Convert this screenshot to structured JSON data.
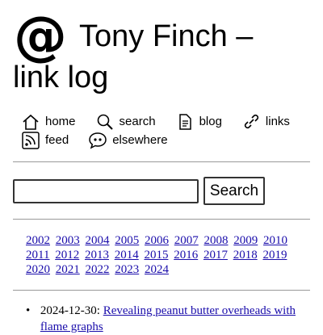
{
  "header": {
    "logo_glyph": "@",
    "title_line1": "Tony Finch –",
    "title_line2": "link log"
  },
  "nav": {
    "items": [
      {
        "label": "home",
        "icon": "home-icon"
      },
      {
        "label": "search",
        "icon": "search-icon"
      },
      {
        "label": "blog",
        "icon": "document-icon"
      },
      {
        "label": "links",
        "icon": "link-icon"
      },
      {
        "label": "feed",
        "icon": "rss-feed-icon"
      },
      {
        "label": "elsewhere",
        "icon": "speech-bubble-icon"
      }
    ]
  },
  "search": {
    "value": "",
    "button_label": "Search"
  },
  "years": {
    "rows": [
      [
        "2002",
        "2003",
        "2004",
        "2005",
        "2006",
        "2007",
        "2008",
        "2009",
        "2010"
      ],
      [
        "2011",
        "2012",
        "2013",
        "2014",
        "2015",
        "2016",
        "2017",
        "2018",
        "2019"
      ],
      [
        "2020",
        "2021",
        "2022",
        "2023",
        "2024"
      ]
    ]
  },
  "posts": [
    {
      "date": "2024-12-30:",
      "title": "Revealing peanut butter overheads with flame graphs"
    }
  ],
  "colors": {
    "link": "#1a0dab",
    "separator": "#999999"
  }
}
